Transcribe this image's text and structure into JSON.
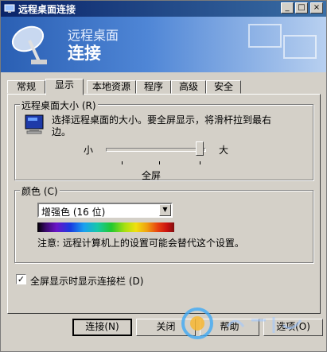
{
  "window": {
    "title": "远程桌面连接",
    "controls": {
      "minimize": "_",
      "maximize": "□",
      "close": "×"
    }
  },
  "banner": {
    "line1": "远程桌面",
    "line2": "连接"
  },
  "tabs": [
    {
      "label": "常规"
    },
    {
      "label": "显示"
    },
    {
      "label": "本地资源"
    },
    {
      "label": "程序"
    },
    {
      "label": "高级"
    },
    {
      "label": "安全"
    }
  ],
  "display": {
    "size_group": {
      "title": "远程桌面大小 (R)",
      "description": "选择远程桌面的大小。要全屏显示，将滑杆拉到最右边。",
      "slider_small": "小",
      "slider_big": "大",
      "slider_value_label": "全屏",
      "slider_level": 1.0
    },
    "color_group": {
      "title": "颜色 (C)",
      "selected": "增强色 (16 位)",
      "note": "注意: 远程计算机上的设置可能会替代这个设置。"
    },
    "show_bar": {
      "label": "全屏显示时显示连接栏 (D)",
      "checked": true
    }
  },
  "buttons": {
    "connect": "连接(N)",
    "close": "关闭",
    "help": "帮助",
    "options": "选项(O)"
  },
  "icons": {
    "app": "remote-desktop-icon",
    "monitor": "monitor-icon",
    "dropdown": "chevron-down-icon"
  },
  "colors": {
    "title_start": "#0a246a",
    "title_end": "#3a6ea5",
    "face": "#d4d0c8"
  }
}
